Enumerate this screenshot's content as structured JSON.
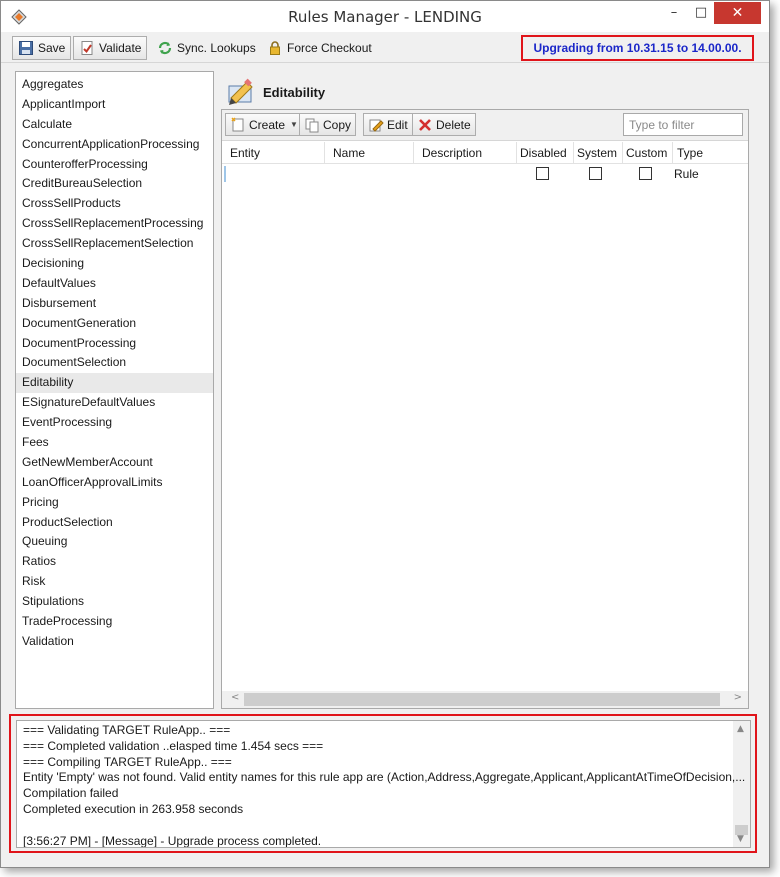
{
  "window": {
    "title": "Rules Manager - LENDING",
    "minimize": "–",
    "maximize": "□",
    "close": "✕"
  },
  "toolbar": {
    "save_label": "Save",
    "validate_label": "Validate",
    "sync_label": "Sync. Lookups",
    "checkout_label": "Force Checkout",
    "upgrade_banner": "Upgrading from 10.31.15 to 14.00.00."
  },
  "sidebar": {
    "selected": "Editability",
    "items": [
      "Aggregates",
      "ApplicantImport",
      "Calculate",
      "ConcurrentApplicationProcessing",
      "CounterofferProcessing",
      "CreditBureauSelection",
      "CrossSellProducts",
      "CrossSellReplacementProcessing",
      "CrossSellReplacementSelection",
      "Decisioning",
      "DefaultValues",
      "Disbursement",
      "DocumentGeneration",
      "DocumentProcessing",
      "DocumentSelection",
      "Editability",
      "ESignatureDefaultValues",
      "EventProcessing",
      "Fees",
      "GetNewMemberAccount",
      "LoanOfficerApprovalLimits",
      "Pricing",
      "ProductSelection",
      "Queuing",
      "Ratios",
      "Risk",
      "Stipulations",
      "TradeProcessing",
      "Validation"
    ]
  },
  "main": {
    "title": "Editability",
    "grid_toolbar": {
      "create_label": "Create",
      "copy_label": "Copy",
      "edit_label": "Edit",
      "delete_label": "Delete",
      "filter_placeholder": "Type to filter"
    },
    "columns": {
      "entity": "Entity",
      "name": "Name",
      "description": "Description",
      "disabled": "Disabled",
      "system": "System",
      "custom": "Custom",
      "type": "Type"
    },
    "rows": [
      {
        "entity": "",
        "name": "",
        "description": "",
        "disabled": false,
        "system": false,
        "custom": false,
        "type": "Rule"
      }
    ]
  },
  "log": {
    "lines": [
      "=== Validating TARGET RuleApp.. ===",
      "=== Completed validation ..elasped time 1.454 secs ===",
      "=== Compiling TARGET RuleApp.. ===",
      "Entity 'Empty' was not found.  Valid entity names for this rule app are (Action,Address,Aggregate,Applicant,ApplicantAtTimeOfDecision,...",
      "Compilation failed",
      "Completed execution in 263.958 seconds",
      "",
      "[3:56:27 PM] - [Message] - Upgrade process completed."
    ]
  },
  "colors": {
    "highlight_border": "#e0141a",
    "banner_text": "#1b27c9",
    "close_button": "#c7372f"
  }
}
